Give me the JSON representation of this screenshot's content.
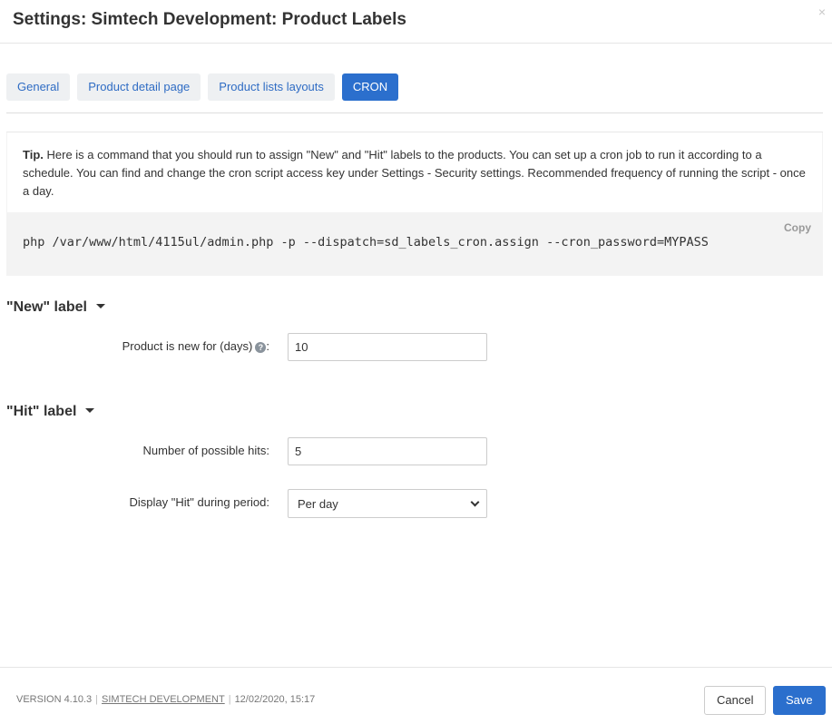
{
  "header": {
    "title": "Settings: Simtech Development: Product Labels",
    "close_symbol": "×"
  },
  "tabs": [
    {
      "label": "General",
      "active": false
    },
    {
      "label": "Product detail page",
      "active": false
    },
    {
      "label": "Product lists layouts",
      "active": false
    },
    {
      "label": "CRON",
      "active": true
    }
  ],
  "tip": {
    "prefix": "Tip.",
    "text": "Here is a command that you should run to assign \"New\" and \"Hit\" labels to the products. You can set up a cron job to run it according to a schedule. You can find and change the cron script access key under Settings - Security settings. Recommended frequency of running the script - once a day.",
    "copy_label": "Copy",
    "command": "php /var/www/html/4115ul/admin.php -p --dispatch=sd_labels_cron.assign --cron_password=MYPASS"
  },
  "new_label": {
    "title": "\"New\" label",
    "field_label": "Product is new for (days)",
    "field_colon": ":",
    "field_value": "10"
  },
  "hit_label": {
    "title": "\"Hit\" label",
    "hits_label": "Number of possible hits:",
    "hits_value": "5",
    "period_label": "Display \"Hit\" during period:",
    "period_value": "Per day"
  },
  "footer": {
    "version": "VERSION 4.10.3",
    "company": "SIMTECH DEVELOPMENT",
    "datetime": "12/02/2020, 15:17",
    "cancel_label": "Cancel",
    "save_label": "Save"
  },
  "colors": {
    "accent": "#2b6fcd",
    "tab_bg": "#eef0f2",
    "code_bg": "#f3f3f3"
  }
}
